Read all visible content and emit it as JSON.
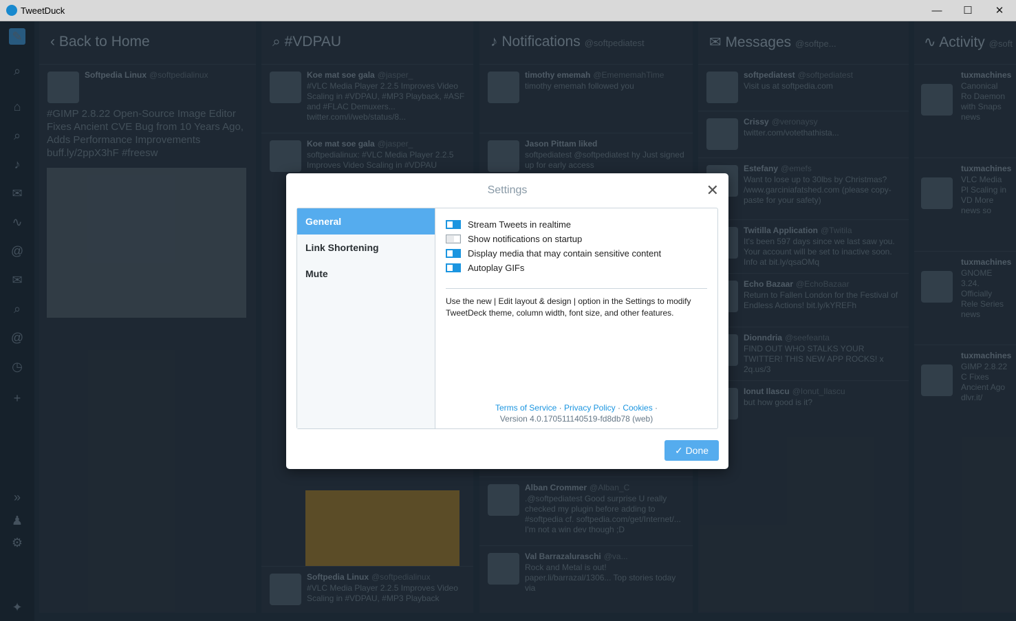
{
  "window": {
    "title": "TweetDuck",
    "minimize": "—",
    "maximize": "☐",
    "close": "✕"
  },
  "columns": [
    {
      "title": "Back to Home",
      "sub": "",
      "tweets": [
        {
          "name": "Softpedia Linux",
          "handle": "@softpedialinux",
          "text": "#GIMP 2.8.22 Open-Source Image Editor Fixes Ancient CVE Bug from 10 Years Ago, Adds Performance Improvements buff.ly/2ppX3hF #freesw"
        }
      ]
    },
    {
      "title": "#VDPAU",
      "sub": "",
      "tweets": [
        {
          "name": "Koe mat soe gala",
          "handle": "@jasper_",
          "text": "#VLC Media Player 2.2.5 Improves Video Scaling in #VDPAU, #MP3 Playback, #ASF and #FLAC Demuxers... twitter.com/i/web/status/8..."
        },
        {
          "name": "Koe mat soe gala",
          "handle": "@jasper_",
          "text": "softpedialinux: #VLC Media Player 2.2.5 Improves Video Scaling in #VDPAU"
        },
        {
          "name": "Softpedia Linux",
          "handle": "@softpedialinux",
          "text": "#VLC Media Player 2.2.5 Improves Video Scaling in #VDPAU, #MP3 Playback"
        }
      ]
    },
    {
      "title": "Notifications",
      "sub": "@softpediatest",
      "tweets": [
        {
          "name": "timothy ememah",
          "handle": "@EmememahTime",
          "text": "timothy ememah followed you"
        },
        {
          "name": "Jason Pittam liked",
          "handle": "",
          "text": "softpediatest @softpediatest hy Just signed up for early access"
        },
        {
          "name": "Alban Crommer",
          "handle": "@Alban_C",
          "text": ".@softpediatest Good surprise U really checked my plugin before adding to #softpedia cf. softpedia.com/get/Internet/... I'm not a win dev though ;D"
        },
        {
          "name": "Val Barrazaluraschi",
          "handle": "@va...",
          "text": "Rock and Metal is out! paper.li/barrazal/1306... Top stories today via"
        }
      ]
    },
    {
      "title": "Messages",
      "sub": "@softpe...",
      "tweets": [
        {
          "name": "softpediatest",
          "handle": "@softpediatest",
          "text": "Visit us at softpedia.com"
        },
        {
          "name": "Crissy",
          "handle": "@veronaysy",
          "text": "twitter.com/votethathista..."
        },
        {
          "name": "Estefany",
          "handle": "@emefs",
          "text": "Want to lose up to 30lbs by Christmas? /www.garciniafatshed.com (please copy-paste for your safety)"
        },
        {
          "name": "Twitilla Application",
          "handle": "@Twitila",
          "text": "It's been 597 days since we last saw you. Your account will be set to inactive soon. Info at bit.ly/qsaOMq"
        },
        {
          "name": "Echo Bazaar",
          "handle": "@EchoBazaar",
          "text": "Return to Fallen London for the Festival of Endless Actions! bit.ly/kYREFh"
        },
        {
          "name": "Dionndria",
          "handle": "@seefeanta",
          "text": "FIND OUT WHO STALKS YOUR TWITTER! THIS NEW APP ROCKS! x 2q.us/3"
        },
        {
          "name": "Ionut Ilascu",
          "handle": "@Ionut_Ilascu",
          "text": "but how good is it?"
        }
      ]
    },
    {
      "title": "Activity",
      "sub": "@soft",
      "tweets": [
        {
          "name": "tuxmachines",
          "handle": "",
          "text": "Canonical Ro Daemon with Snaps news"
        },
        {
          "name": "tuxmachines",
          "handle": "",
          "text": "VLC Media Pl Scaling in VD More news so"
        },
        {
          "name": "tuxmachines",
          "handle": "",
          "text": "GNOME 3.24. Officially Rele Series news"
        },
        {
          "name": "tuxmachines",
          "handle": "",
          "text": "GIMP 2.8.22 C Fixes Ancient Ago dlvr.it/"
        }
      ]
    }
  ],
  "settings": {
    "title": "Settings",
    "close": "✕",
    "tabs": [
      "General",
      "Link Shortening",
      "Mute"
    ],
    "options": [
      {
        "label": "Stream Tweets in realtime",
        "on": true
      },
      {
        "label": "Show notifications on startup",
        "on": false
      },
      {
        "label": "Display media that may contain sensitive content",
        "on": true
      },
      {
        "label": "Autoplay GIFs",
        "on": true
      }
    ],
    "note": "Use the new | Edit layout & design | option in the Settings to modify TweetDeck theme, column width, font size, and other features.",
    "links": {
      "terms": "Terms of Service",
      "sep1": " · ",
      "privacy": "Privacy Policy",
      "sep2": " · ",
      "cookies": "Cookies",
      "sep3": " ·"
    },
    "version": "Version 4.0.170511140519-fd8db78 (web)",
    "done": "✓ Done"
  },
  "colors": {
    "accent": "#55acee",
    "toggle_on": "#1b95e0"
  }
}
